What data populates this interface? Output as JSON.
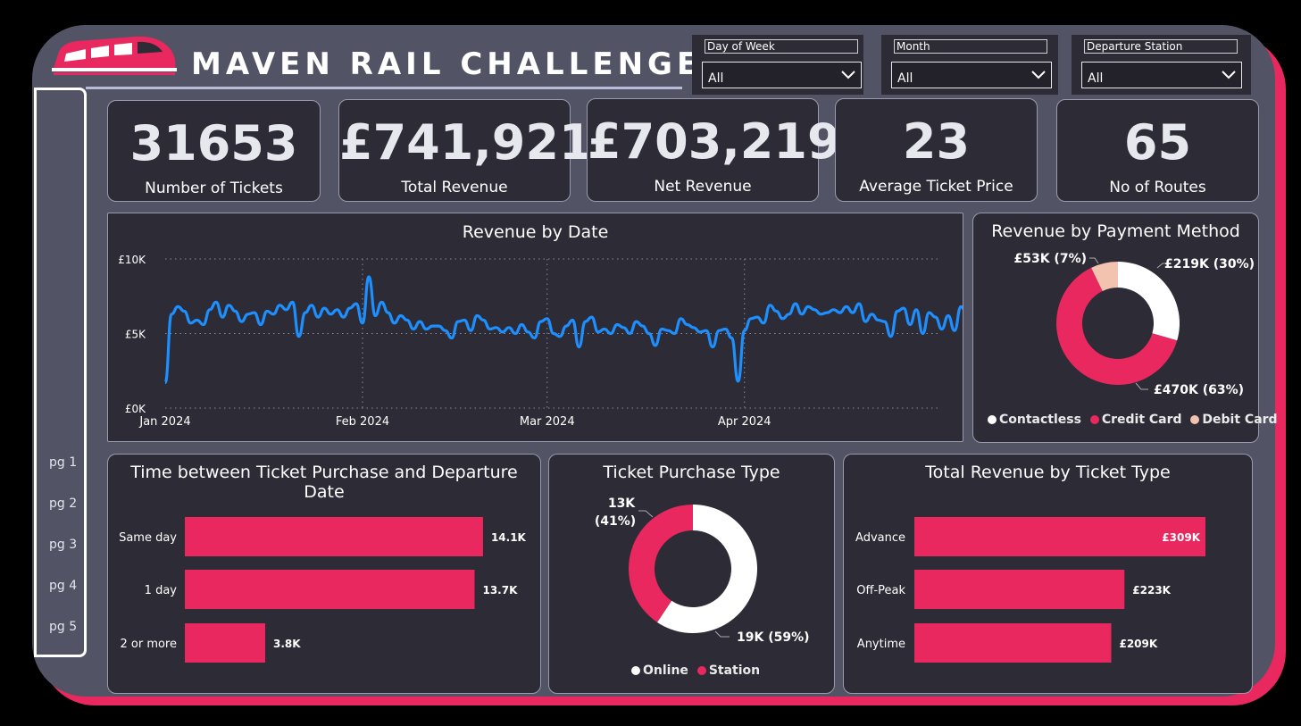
{
  "header": {
    "title": "MAVEN RAIL CHALLENGE"
  },
  "filters": [
    {
      "label": "Day of Week",
      "value": "All"
    },
    {
      "label": "Month",
      "value": "All"
    },
    {
      "label": "Departure Station",
      "value": "All"
    }
  ],
  "nav": {
    "pages": [
      "pg 1",
      "pg 2",
      "pg 3",
      "pg 4",
      "pg 5"
    ]
  },
  "kpis": [
    {
      "value": "31653",
      "label": "Number of Tickets"
    },
    {
      "value": "£741,921",
      "label": "Total Revenue"
    },
    {
      "value": "£703,219",
      "label": "Net Revenue"
    },
    {
      "value": "23",
      "label": "Average Ticket Price"
    },
    {
      "value": "65",
      "label": "No of Routes"
    }
  ],
  "colors": {
    "accent": "#e8285f",
    "line": "#1e8fff",
    "card": "#2c2b36",
    "frame": "#535366",
    "debit": "#f4c3b0"
  },
  "chart_data": [
    {
      "type": "line",
      "title": "Revenue by Date",
      "y_ticks": [
        "£10K",
        "£5K",
        "£0K"
      ],
      "x_ticks": [
        "Jan 2024",
        "Feb 2024",
        "Mar 2024",
        "Apr 2024"
      ],
      "ylim": [
        0,
        10000
      ],
      "x_start": "2024-01-01",
      "values": [
        1700,
        6300,
        6800,
        6500,
        5700,
        5900,
        5600,
        6600,
        7100,
        6100,
        6900,
        6500,
        5800,
        6300,
        6400,
        5600,
        6500,
        6300,
        6900,
        6600,
        7100,
        4800,
        6400,
        6900,
        6100,
        6700,
        6300,
        6600,
        6100,
        6700,
        7000,
        5700,
        8800,
        6200,
        7100,
        6400,
        5700,
        6200,
        5900,
        5300,
        5800,
        5300,
        5500,
        5500,
        5200,
        4700,
        5800,
        5900,
        5200,
        6200,
        5900,
        5300,
        5400,
        5100,
        5400,
        5000,
        5600,
        5100,
        4700,
        5800,
        6000,
        5000,
        4800,
        5500,
        5900,
        4100,
        5800,
        6100,
        5100,
        5300,
        5000,
        5600,
        5400,
        5000,
        5800,
        5500,
        5000,
        4200,
        5300,
        5200,
        5000,
        6000,
        5600,
        5400,
        5100,
        5200,
        4100,
        5200,
        5300,
        4700,
        1800,
        5200,
        6000,
        6100,
        5700,
        6900,
        6500,
        6000,
        6300,
        7000,
        6300,
        6800,
        6600,
        6300,
        6400,
        6600,
        6400,
        6800,
        6400,
        7000,
        5800,
        6300,
        5900,
        5800,
        4800,
        6500,
        6700,
        5600,
        6600,
        5000,
        6400,
        6100,
        5300,
        6200,
        5200,
        6800,
        6300,
        5400,
        6500,
        6500,
        6000,
        6200,
        5700,
        6700,
        5500,
        6200,
        6000,
        6500,
        5800,
        6300,
        5400,
        6000,
        5500,
        6300,
        6600,
        5900,
        5200,
        6200,
        6100,
        1700,
        5900,
        6900,
        5200,
        6000,
        5400,
        6300,
        6300,
        5900,
        5400,
        6800,
        6300,
        5500,
        7300,
        6300,
        5600,
        6800,
        5200,
        6200,
        6400,
        6700,
        5600,
        7000,
        5800,
        5900,
        6500,
        6300,
        6200,
        5400,
        6600,
        6500,
        5100,
        6200,
        6300,
        6100,
        6200,
        6200,
        5700,
        6600,
        6300,
        5600,
        6500,
        6200,
        5700,
        6400,
        6200,
        5500,
        5900,
        6000,
        5600,
        6100,
        5800,
        5400,
        6400,
        6000,
        5600,
        5900,
        6100,
        5500,
        5900,
        6500,
        5700,
        6200,
        6000,
        5900,
        5500,
        5500
      ]
    },
    {
      "type": "pie",
      "title": "Revenue by Payment Method",
      "categories": [
        "Contactless",
        "Credit Card",
        "Debit Card"
      ],
      "values": [
        219,
        470,
        53
      ],
      "labels": [
        "£219K (30%)",
        "£470K (63%)",
        "£53K (7%)"
      ],
      "colors": [
        "#ffffff",
        "#e8285f",
        "#f4c3b0"
      ]
    },
    {
      "type": "bar",
      "title": "Time between Ticket Purchase and Departure Date",
      "categories": [
        "Same day",
        "1 day",
        "2 or more"
      ],
      "values": [
        14.1,
        13.7,
        3.8
      ],
      "labels": [
        "14.1K",
        "13.7K",
        "3.8K"
      ],
      "xlim": [
        0,
        15.2
      ]
    },
    {
      "type": "pie",
      "title": "Ticket Purchase Type",
      "categories": [
        "Online",
        "Station"
      ],
      "values": [
        19,
        13
      ],
      "labels": [
        "19K (59%)",
        "13K",
        "(41%)"
      ],
      "colors": [
        "#ffffff",
        "#e8285f"
      ]
    },
    {
      "type": "bar",
      "title": "Total Revenue by Ticket Type",
      "categories": [
        "Advance",
        "Off-Peak",
        "Anytime"
      ],
      "values": [
        309,
        223,
        209
      ],
      "labels": [
        "£309K",
        "£223K",
        "£209K"
      ],
      "xlim": [
        0,
        309
      ]
    }
  ]
}
